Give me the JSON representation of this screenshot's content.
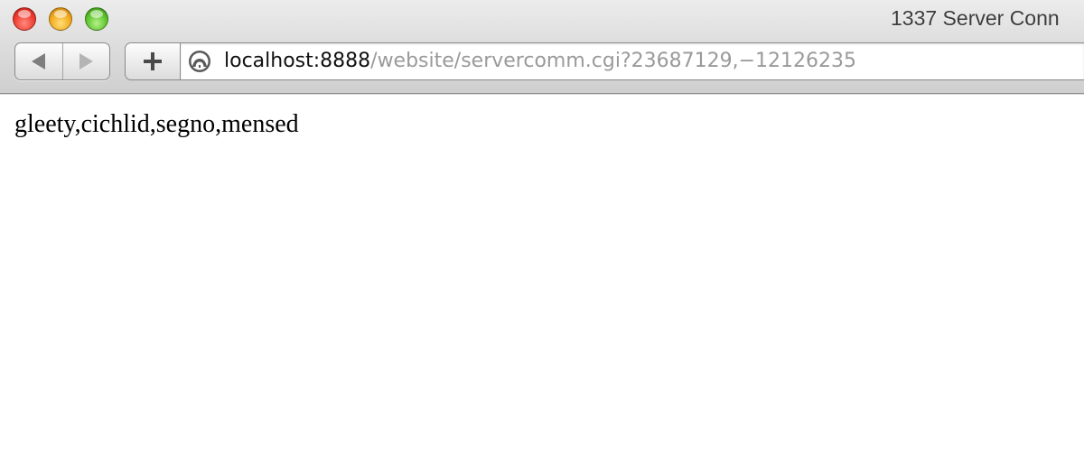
{
  "window": {
    "title": "1337 Server Conn"
  },
  "toolbar": {
    "back_icon": "arrow-left-icon",
    "forward_icon": "arrow-right-icon",
    "add_icon": "plus-icon",
    "site_icon": "globe-icon"
  },
  "address_bar": {
    "host": "localhost:8888",
    "path": "/website/servercomm.cgi?23687129,−12126235"
  },
  "page": {
    "body_text": "gleety,cichlid,segno,mensed"
  }
}
